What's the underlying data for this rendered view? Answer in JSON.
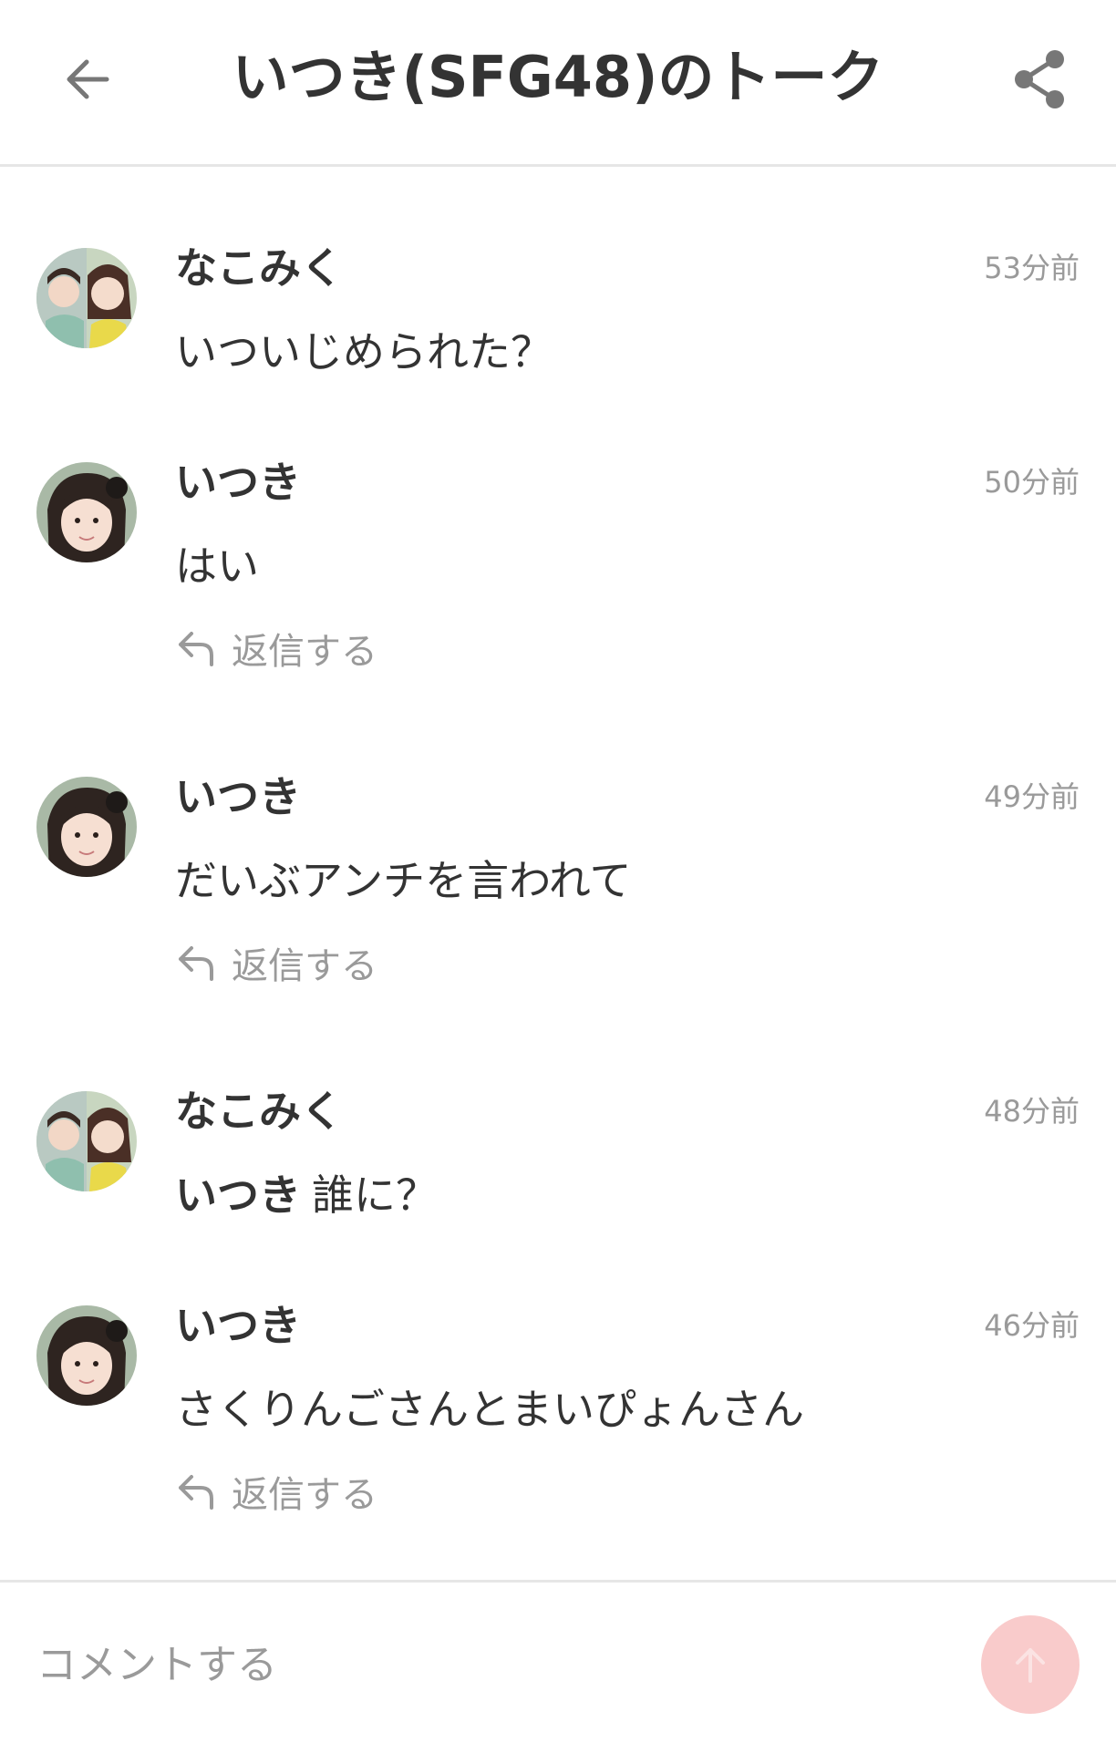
{
  "header": {
    "title": "いつき(SFG48)のトーク",
    "back_icon": "arrow-left-icon",
    "share_icon": "share-icon"
  },
  "comments": [
    {
      "author": "なこみく",
      "avatar": "avatar-nakomiku",
      "time": "53分前",
      "mention": "",
      "text": "いついじめられた？",
      "reply_label": ""
    },
    {
      "author": "いつき",
      "avatar": "avatar-itsuki",
      "time": "50分前",
      "mention": "",
      "text": "はい",
      "reply_label": "返信する"
    },
    {
      "author": "いつき",
      "avatar": "avatar-itsuki",
      "time": "49分前",
      "mention": "",
      "text": "だいぶアンチを言われて",
      "reply_label": "返信する"
    },
    {
      "author": "なこみく",
      "avatar": "avatar-nakomiku",
      "time": "48分前",
      "mention": "いつき",
      "text": "誰に？",
      "reply_label": ""
    },
    {
      "author": "いつき",
      "avatar": "avatar-itsuki",
      "time": "46分前",
      "mention": "",
      "text": "さくりんごさんとまいぴょんさん",
      "reply_label": "返信する"
    }
  ],
  "footer": {
    "input_placeholder": "コメントする",
    "input_value": "",
    "send_icon": "arrow-up-icon"
  },
  "colors": {
    "text": "#333333",
    "muted": "#9a9a9a",
    "divider": "#e6e6e6",
    "send_button": "#f9cbcb"
  }
}
